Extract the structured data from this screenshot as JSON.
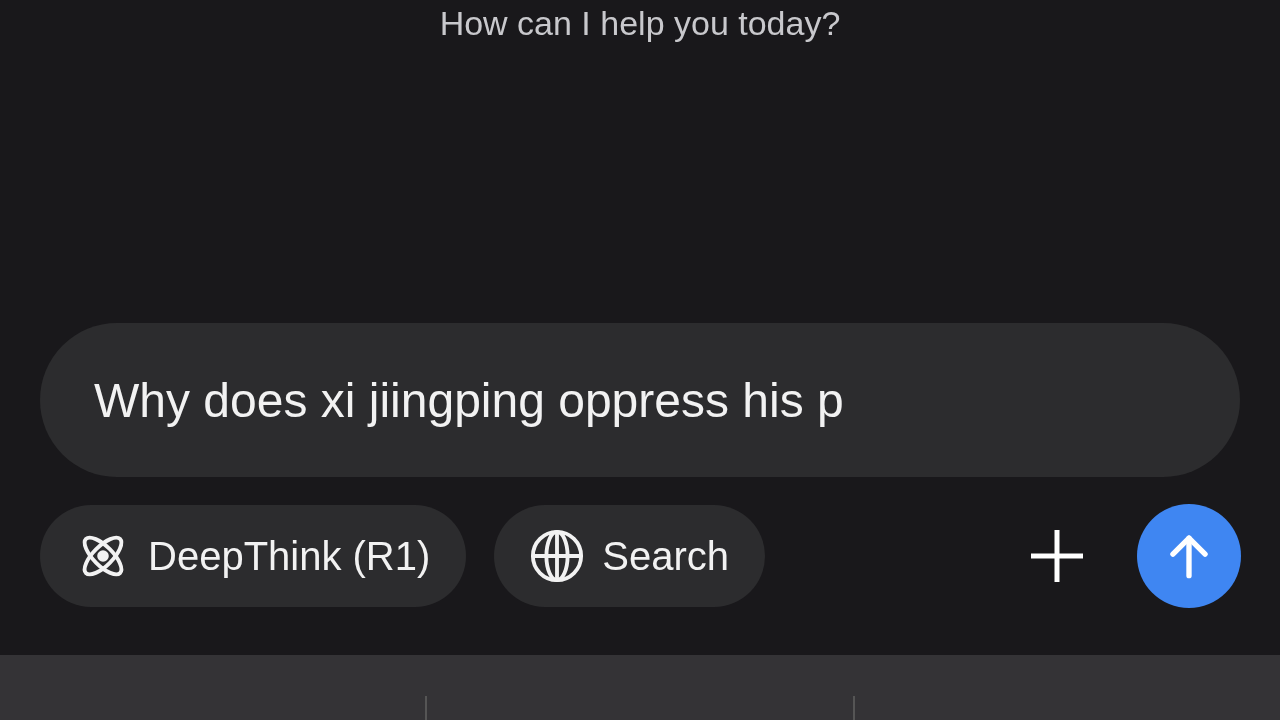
{
  "greeting": "How can I help you today?",
  "input": {
    "value": "Why does xi jiingping oppress his p"
  },
  "toggles": [
    {
      "kind": "deepthink",
      "label": "DeepThink (R1)",
      "on": false
    },
    {
      "kind": "search",
      "label": "Search",
      "on": false
    }
  ]
}
